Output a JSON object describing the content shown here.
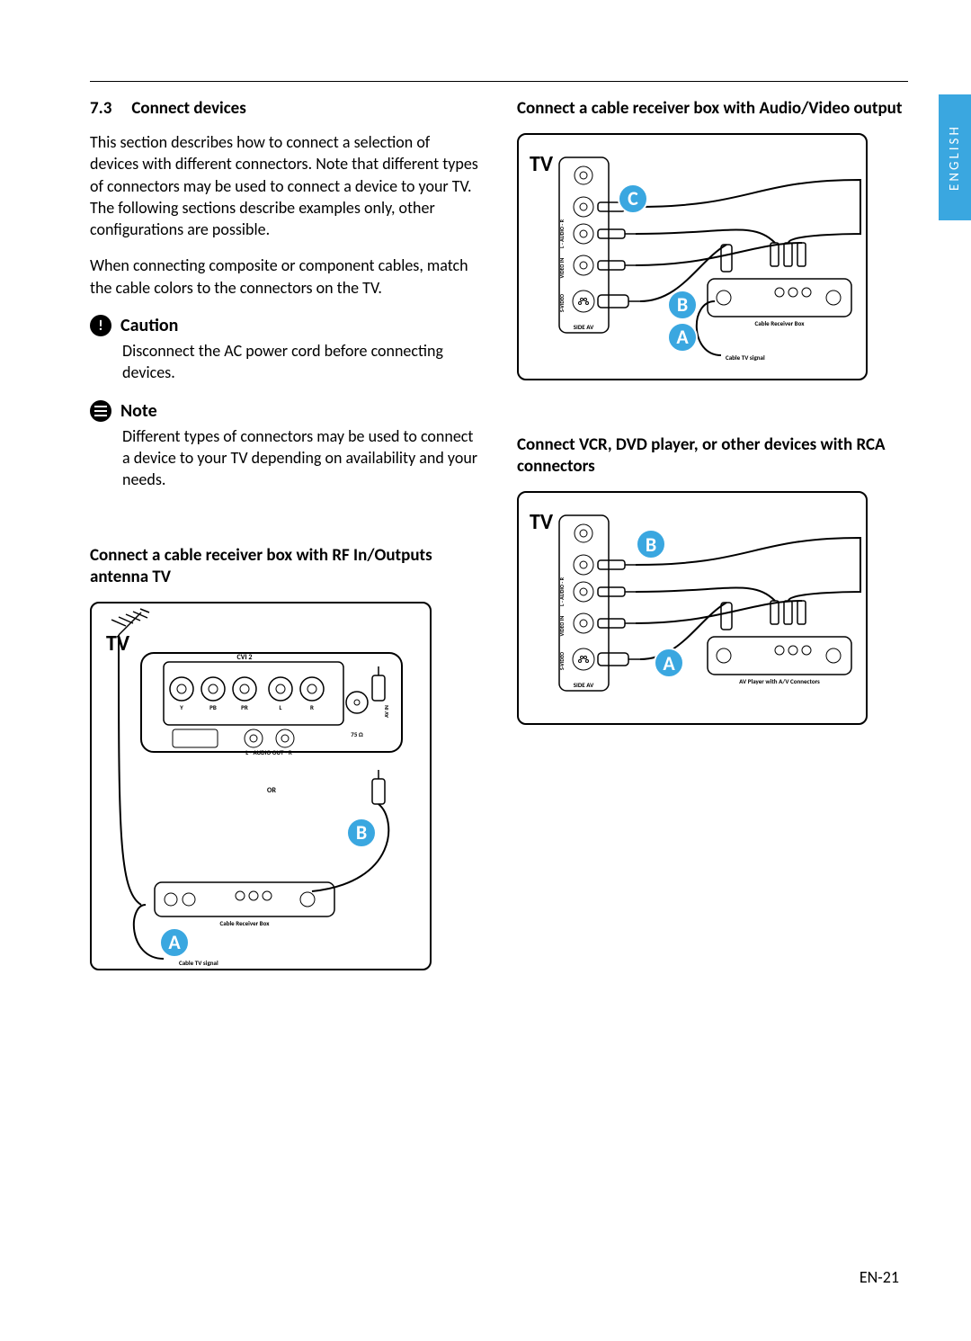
{
  "lang_tab": "ENGLISH",
  "page_number": "EN-21",
  "section": {
    "number": "7.3",
    "title": "Connect devices",
    "intro_p1": "This section describes how to connect a selection of devices with different connectors. Note that different types of connectors may be used to connect a device to your TV.  The following sections describe examples only, other configurations are possible.",
    "intro_p2": "When connecting composite or component cables, match the cable colors to the connectors on the TV."
  },
  "caution": {
    "label": "Caution",
    "text": "Disconnect the AC power cord before connecting devices."
  },
  "note": {
    "label": "Note",
    "text": "Different types of connectors may be used to connect a device to your TV depending on availability and your needs."
  },
  "subheadings": {
    "rf": "Connect a cable receiver box with RF In/Outputs antenna TV",
    "av": "Connect a cable receiver box with Audio/Video output",
    "rca": "Connect  VCR, DVD player, or other devices with RCA connectors"
  },
  "diagrams": {
    "rf": {
      "tv": "TV",
      "or": "OR",
      "cvi": "CVI 2",
      "y": "Y",
      "pb": "PB",
      "pr": "PR",
      "l": "L",
      "r": "R",
      "audio_out": "L - AUDIO OUT - R",
      "ohm": "75 Ω",
      "av_in": "AV IN",
      "box_label": "Cable Receiver Box",
      "signal": "Cable TV signal",
      "badge_a": "A",
      "badge_b": "B"
    },
    "av": {
      "tv": "TV",
      "side": "SIDE AV",
      "audio": "L - AUDIO - R",
      "video_in": "VIDEO IN",
      "svideo": "S-VIDEO",
      "box_label": "Cable Receiver Box",
      "signal": "Cable TV signal",
      "badge_a": "A",
      "badge_b": "B",
      "badge_c": "C"
    },
    "rca": {
      "tv": "TV",
      "side": "SIDE AV",
      "audio": "L - AUDIO - R",
      "video_in": "VIDEO IN",
      "svideo": "S-VIDEO",
      "box_label": "AV Player with A/V Connectors",
      "badge_a": "A",
      "badge_b": "B"
    }
  }
}
